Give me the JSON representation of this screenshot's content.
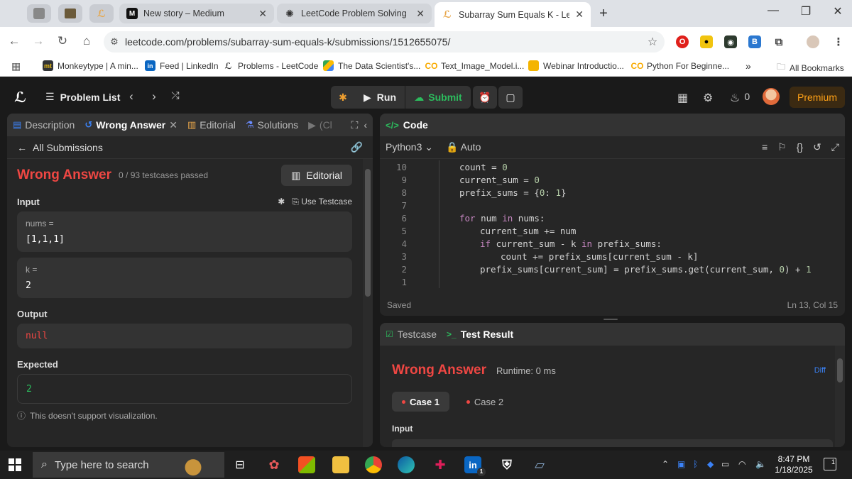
{
  "browser": {
    "tabs": [
      {
        "label": "New story – Medium",
        "favicon": "M",
        "state": "inactive"
      },
      {
        "label": "LeetCode Problem Solving",
        "favicon": "chatgpt",
        "state": "inactive"
      },
      {
        "label": "Subarray Sum Equals K - LeetCo",
        "favicon": "leetcode",
        "state": "active"
      }
    ],
    "url": "leetcode.com/problems/subarray-sum-equals-k/submissions/1512655075/",
    "bookmarks": [
      {
        "label": "Monkeytype | A min...",
        "icon": "mt"
      },
      {
        "label": "Feed | LinkedIn",
        "icon": "in"
      },
      {
        "label": "Problems - LeetCode",
        "icon": "leetcode"
      },
      {
        "label": "The Data Scientist's...",
        "icon": "drive"
      },
      {
        "label": "Text_Image_Model.i...",
        "icon": "colab"
      },
      {
        "label": "Webinar Introductio...",
        "icon": "slides"
      },
      {
        "label": "Python For Beginne...",
        "icon": "colab"
      }
    ],
    "more_bookmarks": "»",
    "all_bookmarks": "All Bookmarks"
  },
  "header": {
    "problem_list": "Problem List",
    "run": "Run",
    "submit": "Submit",
    "streak_count": "0",
    "premium": "Premium"
  },
  "left": {
    "tabs": [
      "Description",
      "Wrong Answer",
      "Editorial",
      "Solutions",
      "(Cl"
    ],
    "all_submissions": "All Submissions",
    "status": "Wrong Answer",
    "passed": "0 / 93 testcases passed",
    "editorial_btn": "Editorial",
    "input_label": "Input",
    "use_testcase": "Use Testcase",
    "inputs": [
      {
        "name": "nums =",
        "value": "[1,1,1]"
      },
      {
        "name": "k =",
        "value": "2"
      }
    ],
    "output_label": "Output",
    "output_value": "null",
    "expected_label": "Expected",
    "expected_value": "2",
    "note": "This doesn't support visualization."
  },
  "code": {
    "title": "Code",
    "language": "Python3",
    "mode": "Auto",
    "lines": [
      {
        "n": "10",
        "text": "count = 0"
      },
      {
        "n": "9",
        "text": "current_sum = 0"
      },
      {
        "n": "8",
        "text": "prefix_sums = {0: 1}"
      },
      {
        "n": "7",
        "text": ""
      },
      {
        "n": "6",
        "text": "for num in nums:"
      },
      {
        "n": "5",
        "text": "current_sum += num"
      },
      {
        "n": "4",
        "text": "if current_sum - k in prefix_sums:"
      },
      {
        "n": "3",
        "text": "count += prefix_sums[current_sum - k]"
      },
      {
        "n": "2",
        "text": "prefix_sums[current_sum] = prefix_sums.get(current_sum, 0) + 1"
      },
      {
        "n": "1",
        "text": ""
      }
    ],
    "saved": "Saved",
    "cursor": "Ln 13, Col 15"
  },
  "test": {
    "tab_testcase": "Testcase",
    "tab_result": "Test Result",
    "status": "Wrong Answer",
    "runtime": "Runtime: 0 ms",
    "diff": "Diff",
    "cases": [
      "Case 1",
      "Case 2"
    ],
    "input_label": "Input"
  },
  "taskbar": {
    "search_placeholder": "Type here to search",
    "time": "8:47 PM",
    "date": "1/18/2025",
    "linkedin_badge": "1",
    "notifications": "1"
  }
}
